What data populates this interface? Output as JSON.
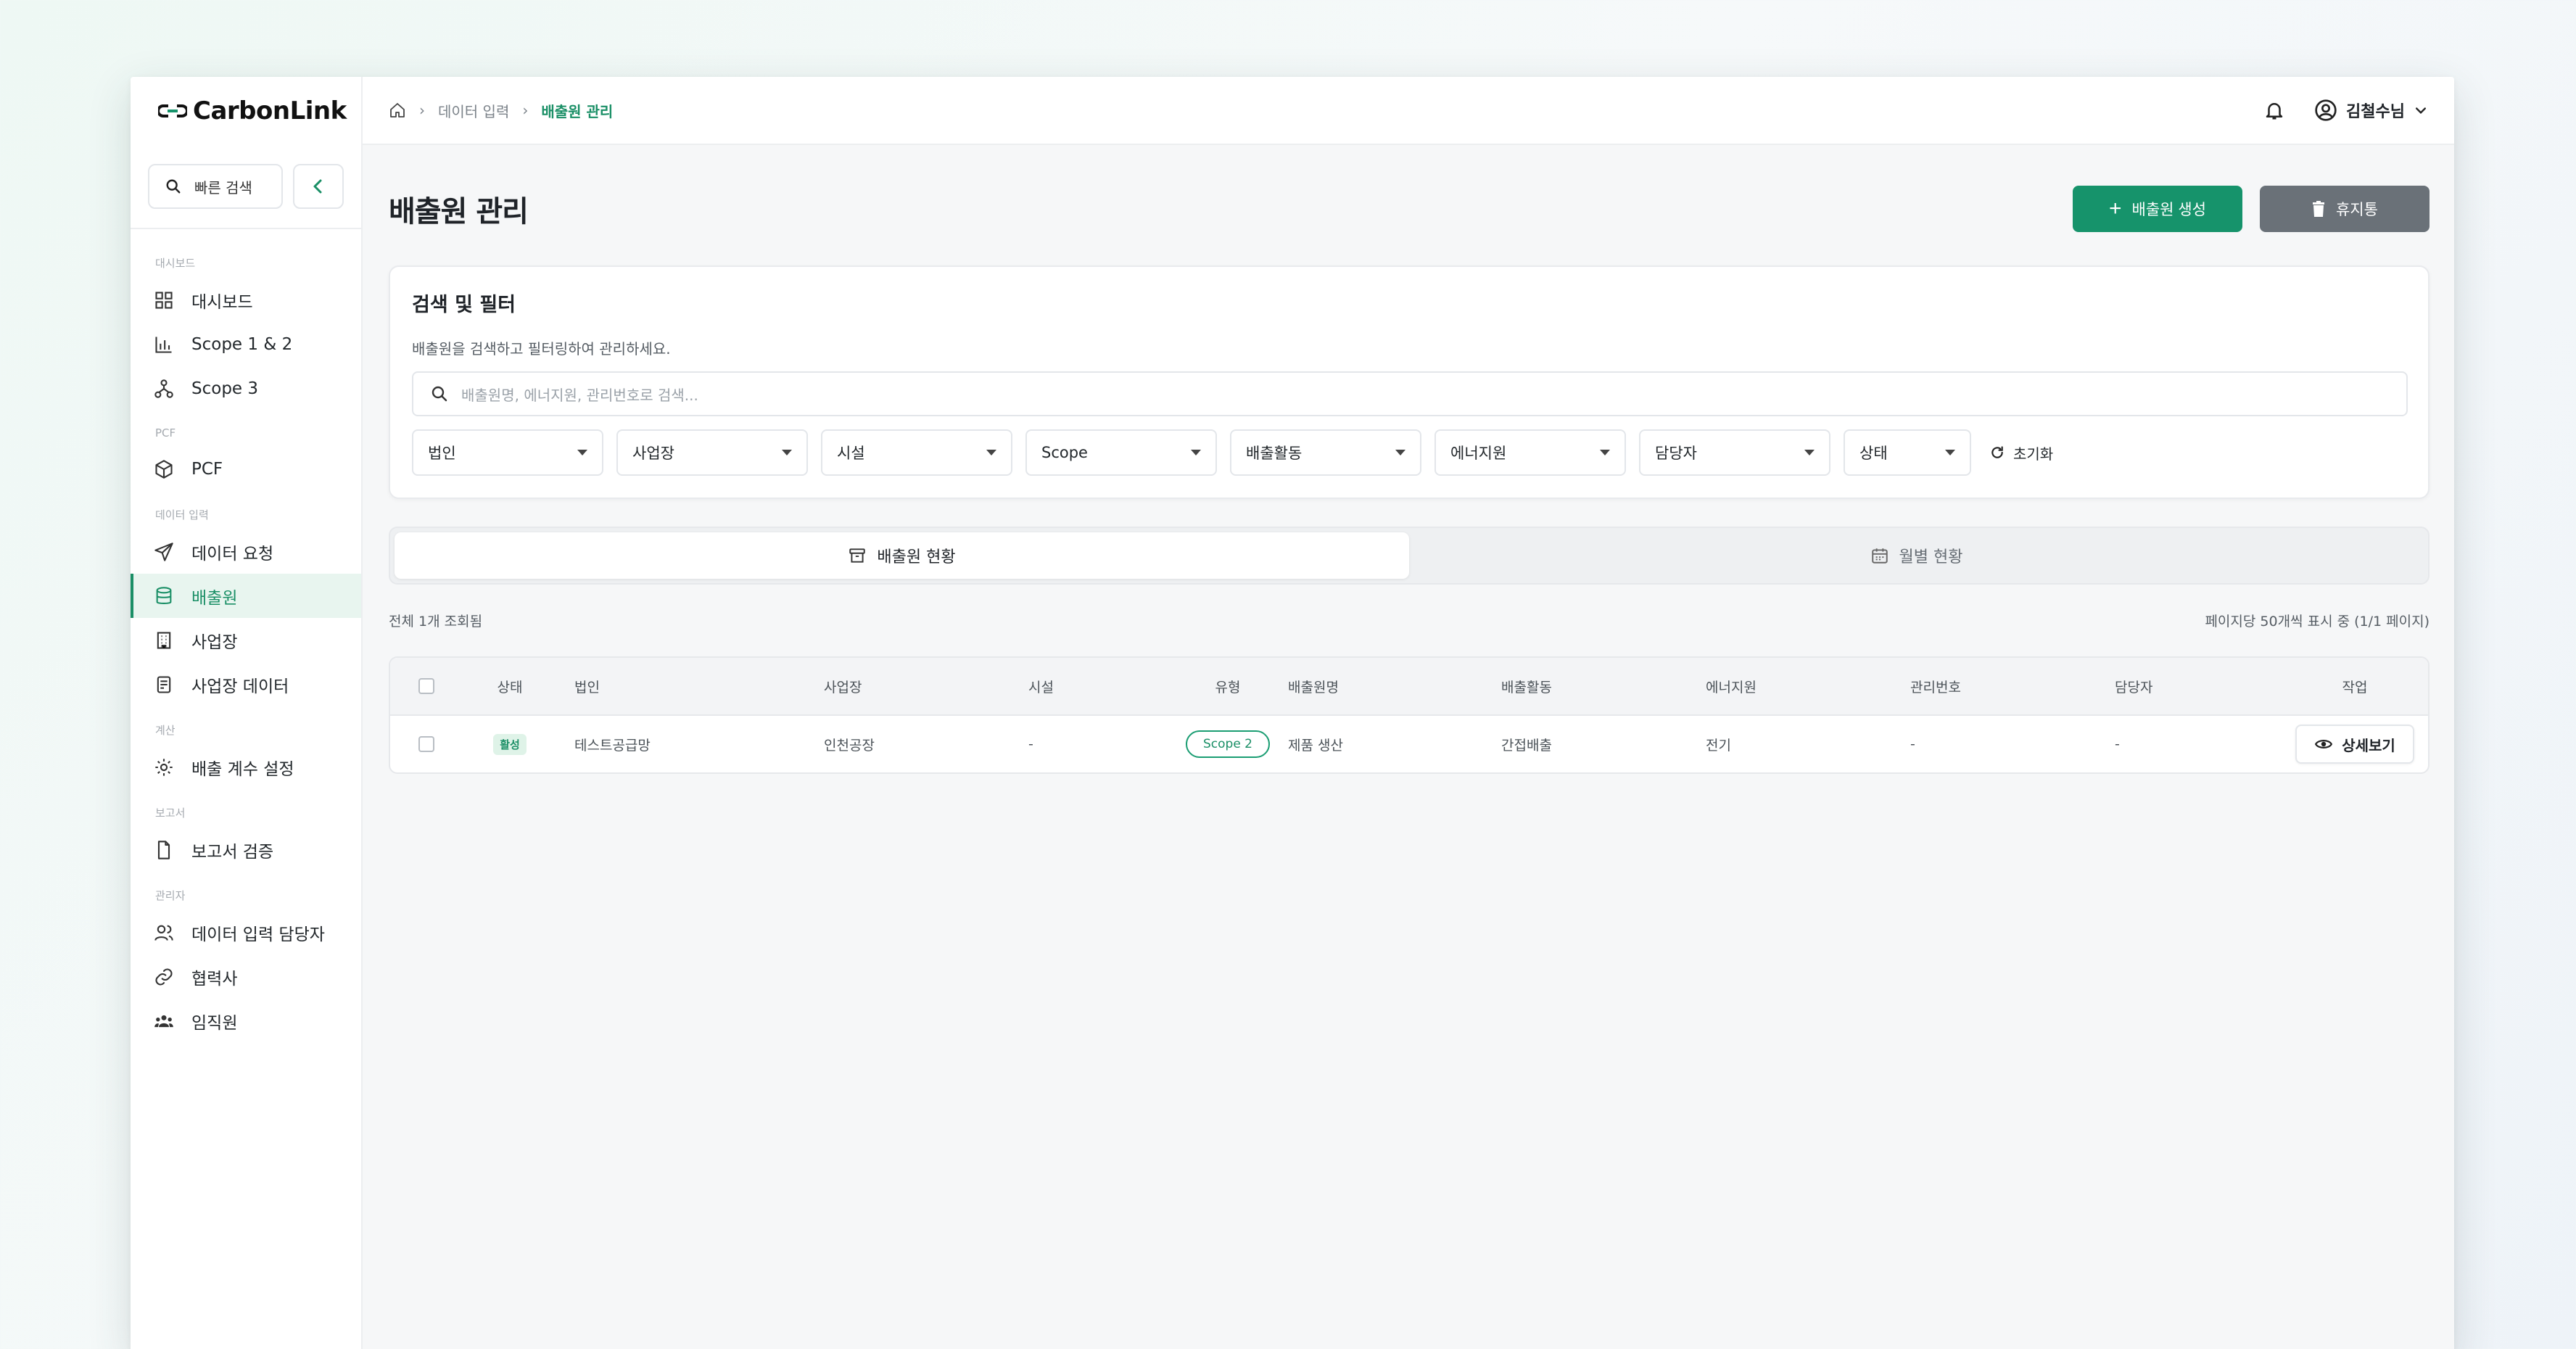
{
  "app": {
    "logo_text_1": "CarbonL",
    "logo_text_2": "ink",
    "brand_color": "#16936b"
  },
  "sidebar": {
    "quick_search": "빠른 검색",
    "sections": [
      {
        "label": "대시보드"
      },
      {
        "label": "PCF"
      },
      {
        "label": "데이터 입력"
      },
      {
        "label": "계산"
      },
      {
        "label": "보고서"
      },
      {
        "label": "관리자"
      }
    ],
    "items": [
      {
        "label": "대시보드",
        "icon": "dashboard-icon"
      },
      {
        "label": "Scope 1 & 2",
        "icon": "bar-chart-icon"
      },
      {
        "label": "Scope 3",
        "icon": "network-icon"
      },
      {
        "label": "PCF",
        "icon": "box-icon"
      },
      {
        "label": "데이터 요청",
        "icon": "send-icon"
      },
      {
        "label": "배출원",
        "icon": "database-icon",
        "active": true
      },
      {
        "label": "사업장",
        "icon": "building-icon"
      },
      {
        "label": "사업장 데이터",
        "icon": "document-data-icon"
      },
      {
        "label": "배출 계수 설정",
        "icon": "gear-icon"
      },
      {
        "label": "보고서 검증",
        "icon": "report-check-icon"
      },
      {
        "label": "데이터 입력 담당자",
        "icon": "users-icon"
      },
      {
        "label": "협력사",
        "icon": "link-icon"
      },
      {
        "label": "임직원",
        "icon": "team-icon"
      }
    ]
  },
  "topbar": {
    "breadcrumb": [
      "데이터 입력",
      "배출원 관리"
    ],
    "user_name": "김철수님"
  },
  "page": {
    "title": "배출원 관리",
    "create_label": "배출원 생성",
    "trash_label": "휴지통"
  },
  "filter_card": {
    "title": "검색 및 필터",
    "description": "배출원을 검색하고 필터링하여 관리하세요.",
    "search_placeholder": "배출원명, 에너지원, 관리번호로 검색...",
    "filters": [
      "법인",
      "사업장",
      "시설",
      "Scope",
      "배출활동",
      "에너지원",
      "담당자",
      "상태"
    ],
    "reset_label": "초기화"
  },
  "tabs": [
    {
      "label": "배출원 현황",
      "active": true
    },
    {
      "label": "월별 현황",
      "active": false
    }
  ],
  "list_info": {
    "total": "전체 1개 조회됨",
    "paging": "페이지당 50개씩 표시 중 (1/1 페이지)"
  },
  "table": {
    "headers": [
      "상태",
      "법인",
      "사업장",
      "시설",
      "유형",
      "배출원명",
      "배출활동",
      "에너지원",
      "관리번호",
      "담당자",
      "작업"
    ],
    "rows": [
      {
        "status": "활성",
        "corp": "테스트공급망",
        "site": "인천공장",
        "facility": "-",
        "type": "Scope 2",
        "name": "제품 생산",
        "activity": "간접배출",
        "energy": "전기",
        "mgmt_no": "-",
        "owner": "-",
        "action": "상세보기"
      }
    ]
  }
}
